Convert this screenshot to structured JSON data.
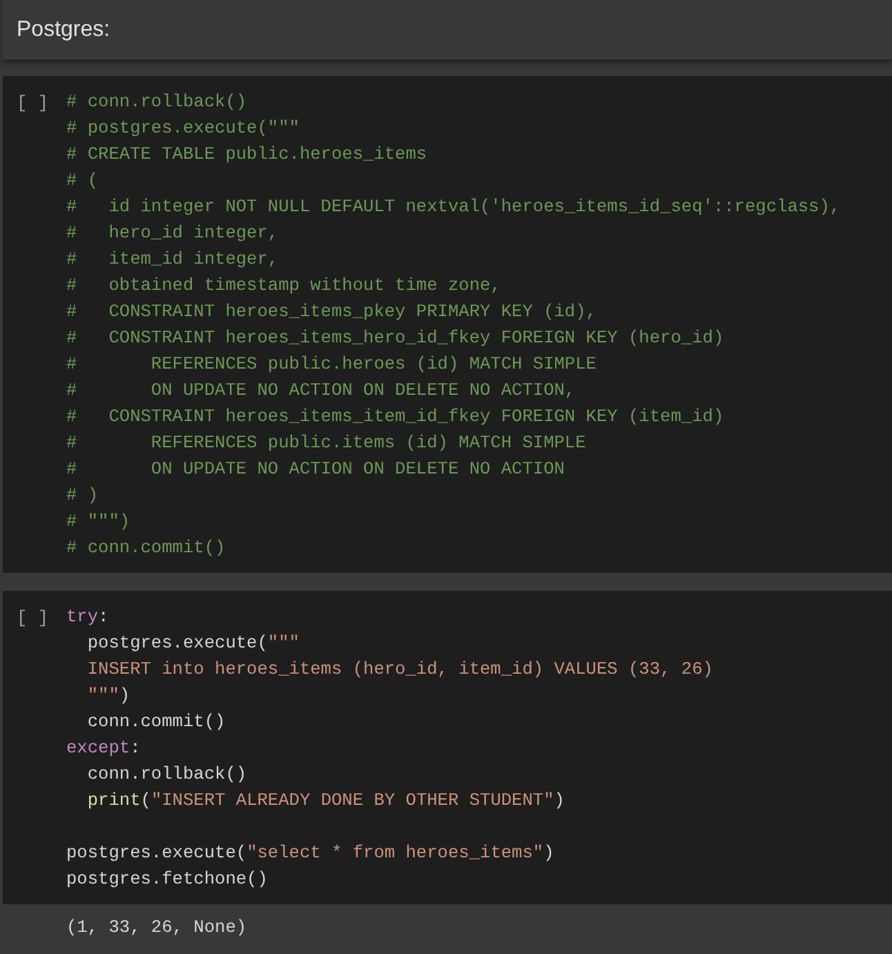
{
  "header": {
    "title": "Postgres:"
  },
  "cells": [
    {
      "prompt": "[ ]",
      "lines": [
        {
          "kind": "code",
          "tokens": [
            {
              "kind": "comment",
              "text": "# conn.rollback()"
            }
          ]
        },
        {
          "kind": "code",
          "tokens": [
            {
              "kind": "comment",
              "text": "# postgres.execute(\"\"\""
            }
          ]
        },
        {
          "kind": "code",
          "tokens": [
            {
              "kind": "comment",
              "text": "# CREATE TABLE public.heroes_items"
            }
          ]
        },
        {
          "kind": "code",
          "tokens": [
            {
              "kind": "comment",
              "text": "# ("
            }
          ]
        },
        {
          "kind": "code",
          "tokens": [
            {
              "kind": "comment",
              "text": "#   id integer NOT NULL DEFAULT nextval('heroes_items_id_seq'::regclass),"
            }
          ]
        },
        {
          "kind": "code",
          "tokens": [
            {
              "kind": "comment",
              "text": "#   hero_id integer,"
            }
          ]
        },
        {
          "kind": "code",
          "tokens": [
            {
              "kind": "comment",
              "text": "#   item_id integer,"
            }
          ]
        },
        {
          "kind": "code",
          "tokens": [
            {
              "kind": "comment",
              "text": "#   obtained timestamp without time zone,"
            }
          ]
        },
        {
          "kind": "code",
          "tokens": [
            {
              "kind": "comment",
              "text": "#   CONSTRAINT heroes_items_pkey PRIMARY KEY (id),"
            }
          ]
        },
        {
          "kind": "code",
          "tokens": [
            {
              "kind": "comment",
              "text": "#   CONSTRAINT heroes_items_hero_id_fkey FOREIGN KEY (hero_id)"
            }
          ]
        },
        {
          "kind": "code",
          "tokens": [
            {
              "kind": "comment",
              "text": "#       REFERENCES public.heroes (id) MATCH SIMPLE"
            }
          ]
        },
        {
          "kind": "code",
          "tokens": [
            {
              "kind": "comment",
              "text": "#       ON UPDATE NO ACTION ON DELETE NO ACTION,"
            }
          ]
        },
        {
          "kind": "code",
          "tokens": [
            {
              "kind": "comment",
              "text": "#   CONSTRAINT heroes_items_item_id_fkey FOREIGN KEY (item_id)"
            }
          ]
        },
        {
          "kind": "code",
          "tokens": [
            {
              "kind": "comment",
              "text": "#       REFERENCES public.items (id) MATCH SIMPLE"
            }
          ]
        },
        {
          "kind": "code",
          "tokens": [
            {
              "kind": "comment",
              "text": "#       ON UPDATE NO ACTION ON DELETE NO ACTION"
            }
          ]
        },
        {
          "kind": "code",
          "tokens": [
            {
              "kind": "comment",
              "text": "# )"
            }
          ]
        },
        {
          "kind": "code",
          "tokens": [
            {
              "kind": "comment",
              "text": "# \"\"\")"
            }
          ]
        },
        {
          "kind": "code",
          "tokens": [
            {
              "kind": "comment",
              "text": "# conn.commit()"
            }
          ]
        }
      ]
    },
    {
      "prompt": "[ ]",
      "lines": [
        {
          "kind": "code",
          "tokens": [
            {
              "kind": "keyword",
              "text": "try"
            },
            {
              "kind": "plain",
              "text": ":"
            }
          ]
        },
        {
          "kind": "code",
          "tokens": [
            {
              "kind": "plain",
              "text": "  postgres.execute("
            },
            {
              "kind": "string",
              "text": "\"\"\""
            }
          ]
        },
        {
          "kind": "code",
          "tokens": [
            {
              "kind": "string",
              "text": "  INSERT into heroes_items (hero_id, item_id) VALUES (33, 26)"
            }
          ]
        },
        {
          "kind": "code",
          "tokens": [
            {
              "kind": "string",
              "text": "  \"\"\""
            },
            {
              "kind": "plain",
              "text": ")"
            }
          ]
        },
        {
          "kind": "code",
          "tokens": [
            {
              "kind": "plain",
              "text": "  conn.commit()"
            }
          ]
        },
        {
          "kind": "code",
          "tokens": [
            {
              "kind": "keyword",
              "text": "except"
            },
            {
              "kind": "plain",
              "text": ":"
            }
          ]
        },
        {
          "kind": "code",
          "tokens": [
            {
              "kind": "plain",
              "text": "  conn.rollback()"
            }
          ]
        },
        {
          "kind": "code",
          "tokens": [
            {
              "kind": "builtin",
              "text": "  print"
            },
            {
              "kind": "plain",
              "text": "("
            },
            {
              "kind": "string",
              "text": "\"INSERT ALREADY DONE BY OTHER STUDENT\""
            },
            {
              "kind": "plain",
              "text": ")"
            }
          ]
        },
        {
          "kind": "blank"
        },
        {
          "kind": "code",
          "tokens": [
            {
              "kind": "plain",
              "text": "postgres.execute("
            },
            {
              "kind": "string",
              "text": "\"select * from heroes_items\""
            },
            {
              "kind": "plain",
              "text": ")"
            }
          ]
        },
        {
          "kind": "code",
          "tokens": [
            {
              "kind": "plain",
              "text": "postgres.fetchone()"
            }
          ]
        }
      ],
      "output": "(1, 33, 26, None)"
    }
  ]
}
